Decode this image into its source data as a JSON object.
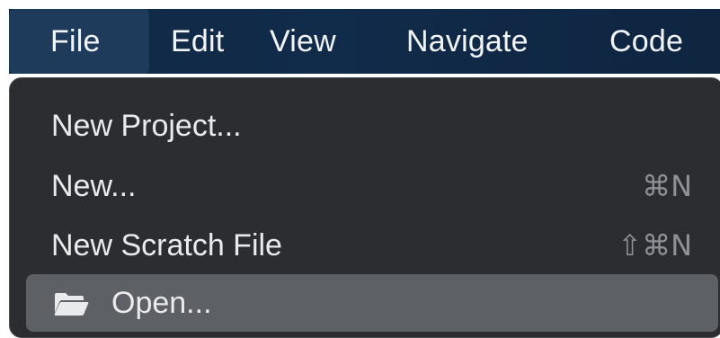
{
  "menubar": {
    "items": [
      {
        "label": "File",
        "active": true
      },
      {
        "label": "Edit",
        "active": false
      },
      {
        "label": "View",
        "active": false
      },
      {
        "label": "Navigate",
        "active": false
      },
      {
        "label": "Code",
        "active": false
      }
    ]
  },
  "dropdown": {
    "items": [
      {
        "label": "New Project...",
        "shortcut": ""
      },
      {
        "label": "New...",
        "shortcut": "⌘N"
      },
      {
        "label": "New Scratch File",
        "shortcut": "⇧⌘N"
      },
      {
        "label": "Open...",
        "shortcut": "",
        "icon": "folder-open-icon",
        "highlighted": true
      }
    ]
  },
  "colors": {
    "menubar_bg": "#112b4a",
    "menubar_active": "#1e3b5c",
    "dropdown_bg": "#2b2d31",
    "highlight_bg": "#5d6166",
    "text": "#e9eaec",
    "shortcut_text": "#8e9196"
  }
}
